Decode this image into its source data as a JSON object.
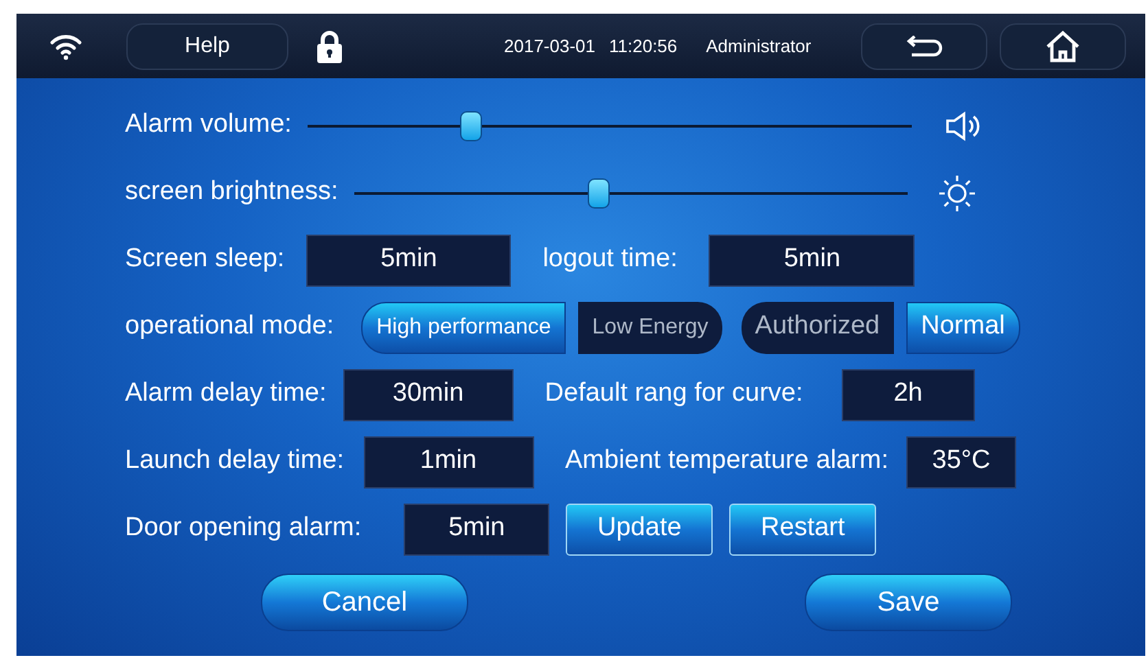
{
  "top_bar": {
    "help": "Help",
    "date": "2017-03-01",
    "time": "11:20:56",
    "user": "Administrator"
  },
  "sliders": [
    {
      "kind": "volume",
      "label": "Alarm volume:",
      "level": 0.27
    },
    {
      "kind": "brightness",
      "label": "screen brightness:",
      "level": 0.44
    }
  ],
  "rows": [
    {
      "kind": "pair",
      "items": [
        {
          "label": "Screen sleep:",
          "value": "5min"
        },
        {
          "label": "logout time:",
          "value": "5min"
        }
      ]
    },
    {
      "kind": "mode",
      "label": "operational mode:",
      "groups": [
        [
          {
            "label": "High performance",
            "selected": true
          },
          {
            "label": "Low Energy",
            "selected": false
          }
        ],
        [
          {
            "label": "Authorized",
            "selected": false
          },
          {
            "label": "Normal",
            "selected": true
          }
        ]
      ]
    },
    {
      "kind": "pair",
      "items": [
        {
          "label": "Alarm delay time:",
          "value": "30min"
        },
        {
          "label": "Default rang for curve:",
          "value": "2h"
        }
      ]
    },
    {
      "kind": "pair",
      "items": [
        {
          "label": "Launch delay time:",
          "value": "1min"
        },
        {
          "label": "Ambient temperature alarm:",
          "value": "35°C"
        }
      ]
    },
    {
      "kind": "actions",
      "items": [
        {
          "label": "Door opening alarm:",
          "value": "5min"
        }
      ],
      "buttons": [
        "Update",
        "Restart"
      ]
    }
  ],
  "footer": [
    "Cancel",
    "Save"
  ]
}
